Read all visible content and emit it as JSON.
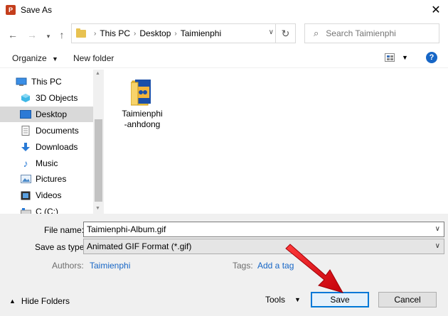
{
  "window": {
    "title": "Save As",
    "app_icon_letter": "P"
  },
  "address": {
    "crumbs": [
      "This PC",
      "Desktop",
      "Taimienphi"
    ]
  },
  "search": {
    "placeholder": "Search Taimienphi"
  },
  "toolbar": {
    "organize_label": "Organize",
    "new_folder_label": "New folder"
  },
  "sidebar": {
    "items": [
      {
        "label": "This PC",
        "icon": "pc-icon"
      },
      {
        "label": "3D Objects",
        "icon": "cube-icon"
      },
      {
        "label": "Desktop",
        "icon": "desktop-icon"
      },
      {
        "label": "Documents",
        "icon": "document-icon"
      },
      {
        "label": "Downloads",
        "icon": "download-icon"
      },
      {
        "label": "Music",
        "icon": "music-icon"
      },
      {
        "label": "Pictures",
        "icon": "pictures-icon"
      },
      {
        "label": "Videos",
        "icon": "video-icon"
      },
      {
        "label": "C (C:)",
        "icon": "drive-icon"
      }
    ]
  },
  "files": [
    {
      "name_line1": "Taimienphi",
      "name_line2": "-anhdong",
      "icon": "folder-icon"
    }
  ],
  "form": {
    "filename_label": "File name:",
    "filename_value": "Taimienphi-Album.gif",
    "savetype_label": "Save as type:",
    "savetype_value": "Animated GIF Format (*.gif)",
    "authors_label": "Authors:",
    "authors_value": "Taimienphi",
    "tags_label": "Tags:",
    "tags_value": "Add a tag"
  },
  "footer": {
    "hide_folders_label": "Hide Folders",
    "tools_label": "Tools",
    "save_label": "Save",
    "cancel_label": "Cancel"
  },
  "colors": {
    "accent": "#0078d7",
    "link": "#1766c6",
    "annotation_arrow": "#e8141b"
  }
}
